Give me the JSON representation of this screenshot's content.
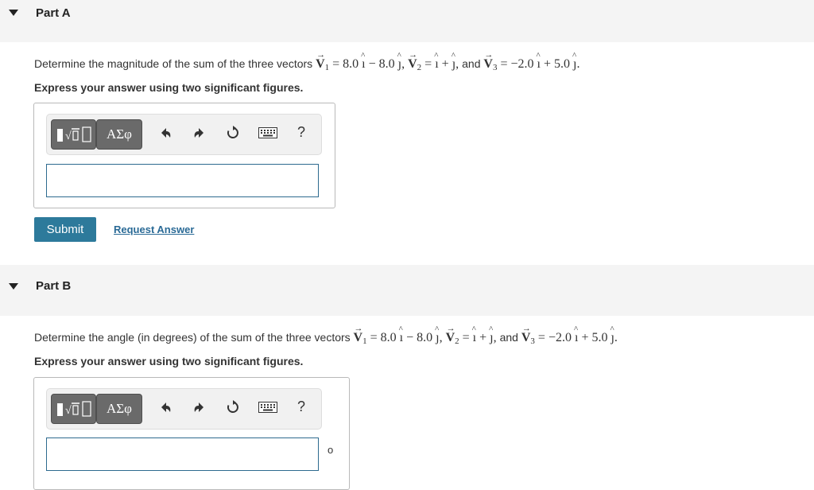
{
  "partA": {
    "title": "Part A",
    "question_prefix": "Determine the magnitude of the sum of the three vectors",
    "instruction": "Express your answer using two significant figures.",
    "submit_label": "Submit",
    "request_label": "Request Answer"
  },
  "partB": {
    "title": "Part B",
    "question_prefix": "Determine the angle (in degrees) of the sum of the three vectors",
    "instruction": "Express your answer using two significant figures.",
    "unit": "o"
  },
  "vectors": {
    "v1_x": "8.0",
    "v1_y": "8.0",
    "v3_x": "−2.0",
    "v3_y": "5.0",
    "and_word": "and"
  },
  "toolbar": {
    "symbols_label": "ΑΣφ",
    "help_label": "?"
  },
  "colors": {
    "accent": "#2d7a9b",
    "link": "#2a6a96",
    "header_bg": "#f4f4f4"
  }
}
